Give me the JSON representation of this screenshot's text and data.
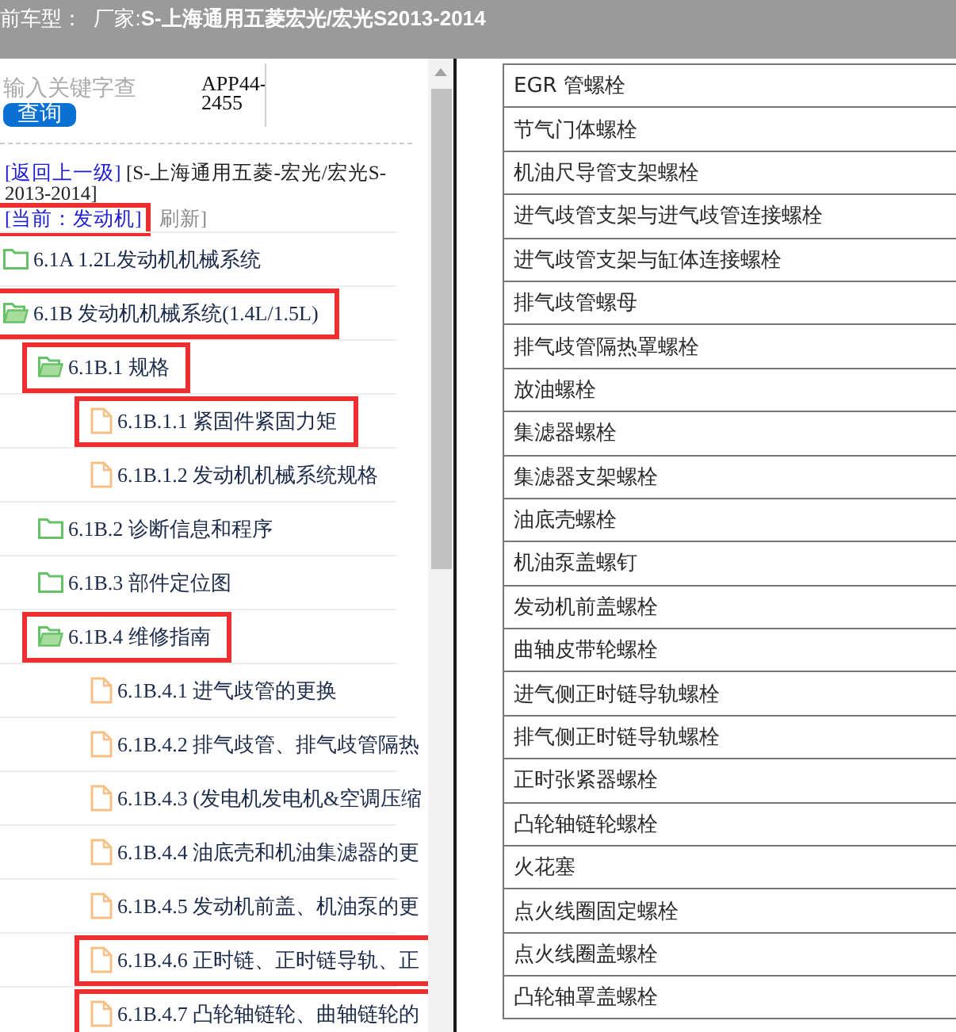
{
  "header": {
    "text": "前车型：  厂家:**S-上海通用五菱宏光/宏光S2013-2014**"
  },
  "search": {
    "placeholder": "输入关键字查",
    "button": "查询",
    "code": "APP44-2455"
  },
  "breadcrumb": {
    "back_link": "[返回上一级]",
    "path": "[S-上海通用五菱-宏光/宏光S-2013-2014]",
    "current": {
      "label": "[当前：发动机]",
      "highlighted": true
    },
    "refresh": "刷新]"
  },
  "tree": [
    {
      "label": "6.1A 1.2L发动机机械系统",
      "kind": "folder",
      "expanded": false,
      "highlighted": false
    },
    {
      "label": "6.1B 发动机机械系统(1.4L/1.5L)",
      "kind": "folder",
      "expanded": true,
      "highlighted": true,
      "children": [
        {
          "label": "6.1B.1 规格",
          "kind": "folder",
          "expanded": true,
          "highlighted": true,
          "children": [
            {
              "label": "6.1B.1.1 紧固件紧固力矩",
              "kind": "document",
              "highlighted": true
            },
            {
              "label": "6.1B.1.2 发动机机械系统规格",
              "kind": "document",
              "highlighted": false
            }
          ]
        },
        {
          "label": "6.1B.2 诊断信息和程序",
          "kind": "folder",
          "expanded": false,
          "highlighted": false
        },
        {
          "label": "6.1B.3 部件定位图",
          "kind": "folder",
          "expanded": false,
          "highlighted": false
        },
        {
          "label": "6.1B.4 维修指南",
          "kind": "folder",
          "expanded": true,
          "highlighted": true,
          "children": [
            {
              "label": "6.1B.4.1 进气歧管的更换",
              "kind": "document",
              "highlighted": false
            },
            {
              "label": "6.1B.4.2 排气歧管、排气歧管隔热",
              "kind": "document",
              "highlighted": false
            },
            {
              "label": "6.1B.4.3 (发电机发电机&空调压缩",
              "kind": "document",
              "highlighted": false
            },
            {
              "label": "6.1B.4.4 油底壳和机油集滤器的更",
              "kind": "document",
              "highlighted": false
            },
            {
              "label": "6.1B.4.5 发动机前盖、机油泵的更",
              "kind": "document",
              "highlighted": false
            },
            {
              "label": "6.1B.4.6 正时链、正时链导轨、正",
              "kind": "document",
              "highlighted": true
            },
            {
              "label": "6.1B.4.7 凸轮轴链轮、曲轴链轮的",
              "kind": "document",
              "highlighted": true
            }
          ]
        }
      ]
    }
  ],
  "torque_table": {
    "rows": [
      "EGR 管螺栓",
      "节气门体螺栓",
      "机油尺导管支架螺栓",
      "进气歧管支架与进气歧管连接螺栓",
      "进气歧管支架与缸体连接螺栓",
      "排气歧管螺母",
      "排气歧管隔热罩螺栓",
      "放油螺栓",
      "集滤器螺栓",
      "集滤器支架螺栓",
      "油底壳螺栓",
      "机油泵盖螺钉",
      "发动机前盖螺栓",
      "曲轴皮带轮螺栓",
      "进气侧正时链导轨螺栓",
      "排气侧正时链导轨螺栓",
      "正时张紧器螺栓",
      "凸轮轴链轮螺栓",
      "火花塞",
      "点火线圈固定螺栓",
      "点火线圈盖螺栓",
      "凸轮轴罩盖螺栓"
    ]
  }
}
